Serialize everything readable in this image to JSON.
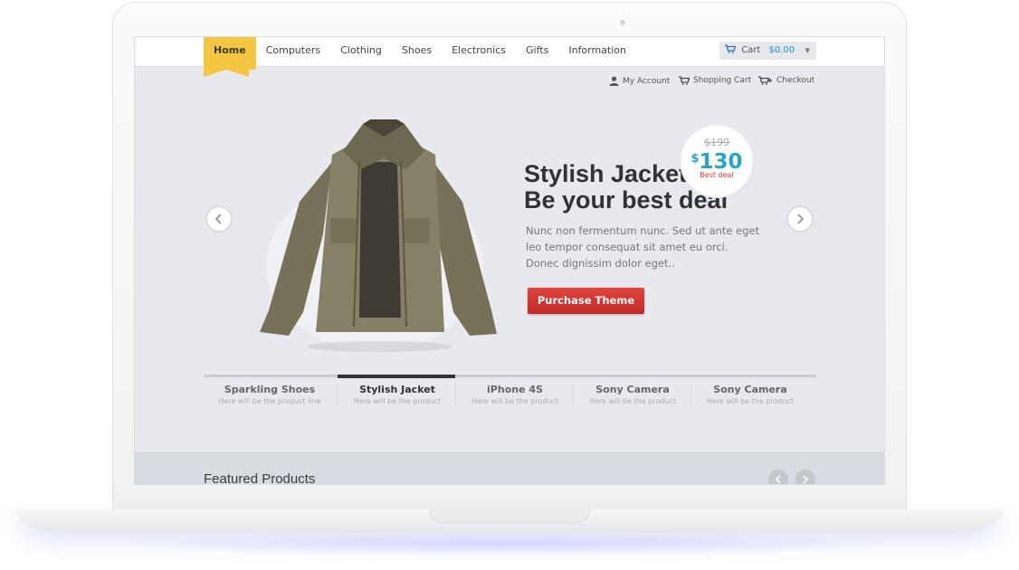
{
  "nav": {
    "items": [
      "Home",
      "Computers",
      "Clothing",
      "Shoes",
      "Electronics",
      "Gifts",
      "Information"
    ],
    "active": "Home"
  },
  "cart": {
    "label": "Cart",
    "amount": "$0.00"
  },
  "utility_links": {
    "account": "My Account",
    "shopping_cart": "Shopping Cart",
    "checkout": "Checkout"
  },
  "hero": {
    "title_line1": "Stylish Jacket",
    "title_line2": "Be your best deal",
    "description_line1": "Nunc non fermentum nunc. Sed ut ante eget",
    "description_line2": "leo tempor consequat sit amet eu orci.",
    "description_line3": "Donec dignissim dolor eget..",
    "cta_label": "Purchase Theme",
    "badge": {
      "old_price": "$199",
      "currency": "$",
      "new_price": "130",
      "deal_label": "Best deal"
    }
  },
  "slider_tabs": [
    {
      "title": "Sparkling Shoes",
      "subtitle": "Here will be the product line"
    },
    {
      "title": "Stylish Jacket",
      "subtitle": "Here will be the product"
    },
    {
      "title": "iPhone 4S",
      "subtitle": "Here will be the product"
    },
    {
      "title": "Sony Camera",
      "subtitle": "Here will be the product"
    },
    {
      "title": "Sony Camera",
      "subtitle": "Here will be the product"
    }
  ],
  "active_tab": "Stylish Jacket",
  "featured": {
    "title": "Featured Products"
  },
  "colors": {
    "accent_yellow": "#f5c640",
    "cta_red": "#d3362f",
    "price_blue": "#28a6c7",
    "cart_amount_blue": "#1d8fd6"
  },
  "icons": {
    "account": "user-icon",
    "shopping_cart": "cart-icon",
    "checkout": "cart-plus-icon",
    "prev": "chevron-left-icon",
    "next": "chevron-right-icon"
  }
}
